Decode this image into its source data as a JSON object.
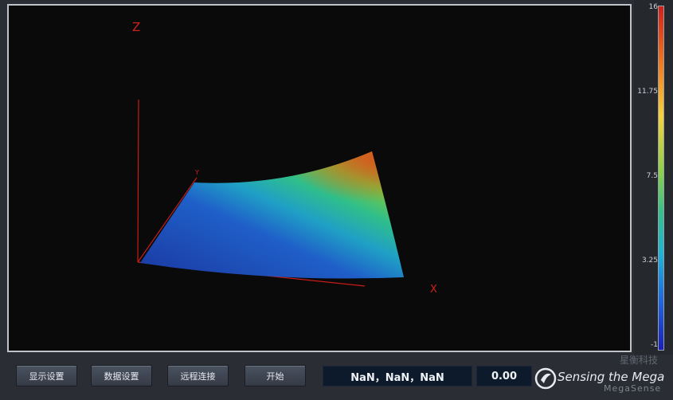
{
  "plot": {
    "axis_z_label": "Z",
    "axis_y_label": "Y",
    "axis_x_label": "X"
  },
  "colorbar": {
    "ticks": [
      "16",
      "11.75",
      "7.5",
      "3.25",
      "-1"
    ],
    "max": 16,
    "min": -1
  },
  "toolbar": {
    "btn_display": "显示设置",
    "btn_data": "数据设置",
    "btn_remote": "远程连接",
    "btn_start": "开始",
    "coords": "NaN，NaN，NaN",
    "value": "0.00"
  },
  "logo": {
    "name": "Sensing the Mega",
    "sub": "MegaSense",
    "cn": "星衡科技"
  },
  "colors": {
    "axis_red": "#d0201a",
    "background": "#0a0a0a",
    "panel": "#2a2d33"
  }
}
